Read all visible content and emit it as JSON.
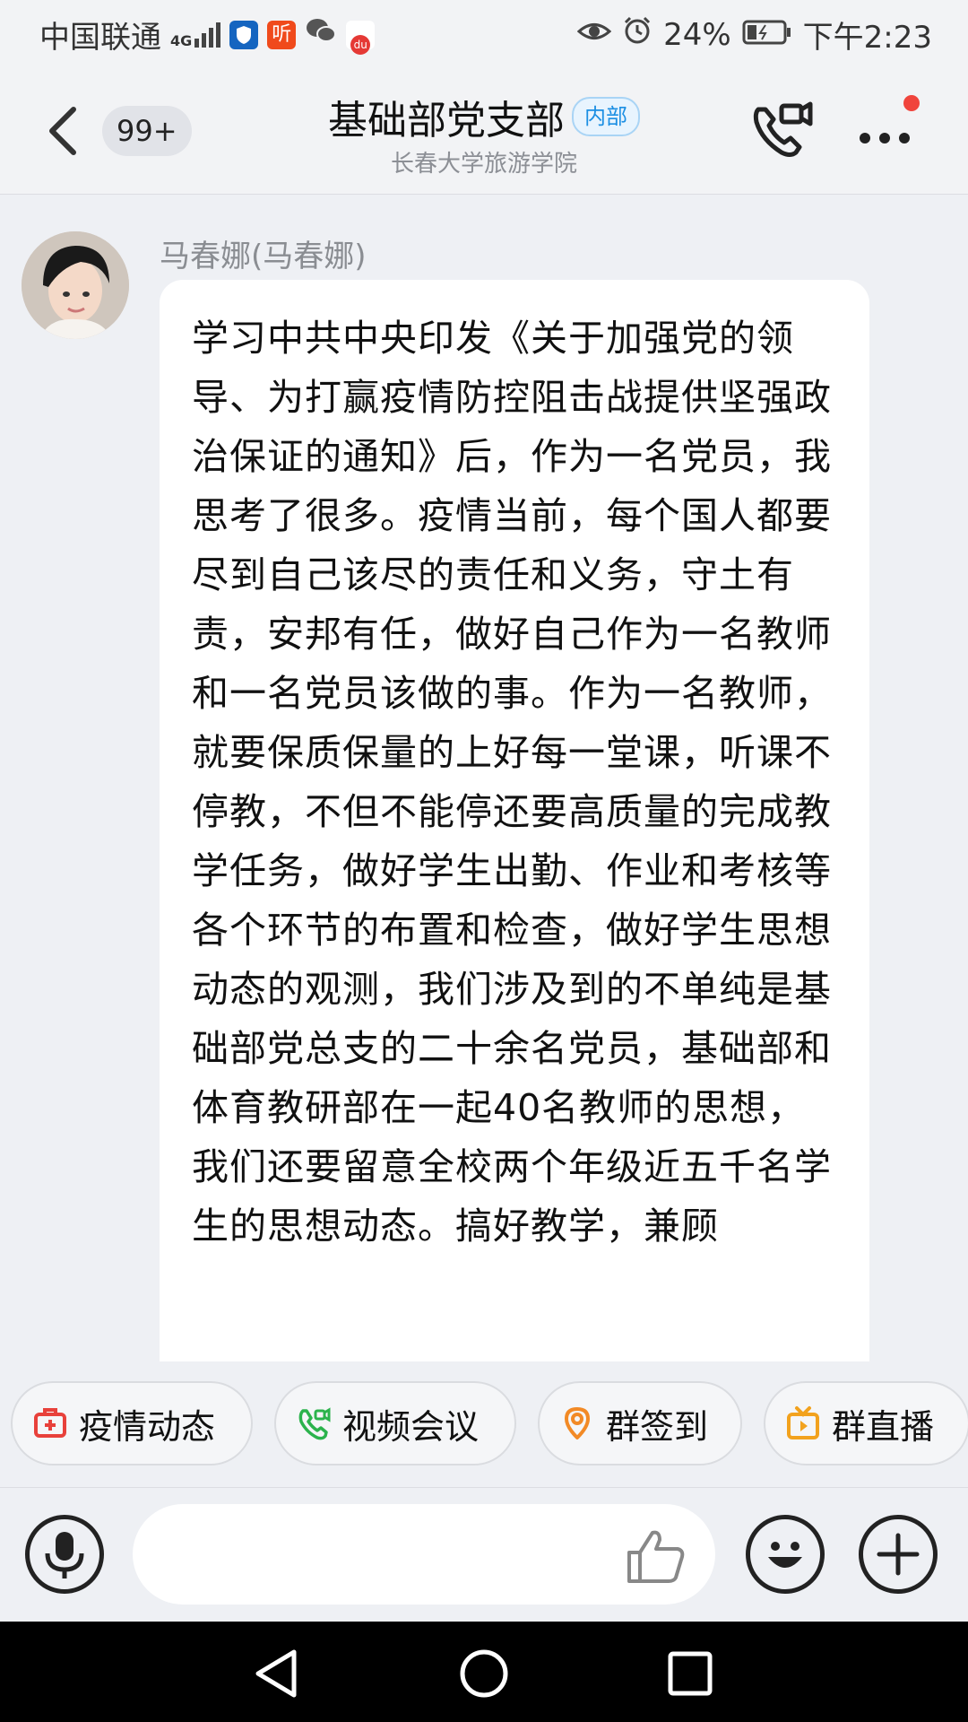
{
  "status_bar": {
    "carrier": "中国联通",
    "network": "4G",
    "battery": "24%",
    "time": "下午2:23",
    "app_icons": [
      "shield-app-icon",
      "ting-app-icon",
      "wechat-icon",
      "du-app-icon"
    ],
    "app_icon_label_ting": "听",
    "app_icon_label_du": "du"
  },
  "header": {
    "back_badge": "99+",
    "title": "基础部党支部",
    "tag": "内部",
    "subtitle": "长春大学旅游学院"
  },
  "message": {
    "sender": "马春娜(马春娜)",
    "text": "学习中共中央印发《关于加强党的领导、为打赢疫情防控阻击战提供坚强政治保证的通知》后，作为一名党员，我思考了很多。疫情当前，每个国人都要尽到自己该尽的责任和义务，守土有责，安邦有任，做好自己作为一名教师和一名党员该做的事。作为一名教师，就要保质保量的上好每一堂课，听课不停教，不但不能停还要高质量的完成教学任务，做好学生出勤、作业和考核等各个环节的布置和检查，做好学生思想动态的观测，我们涉及到的不单纯是基础部党总支的二十余名党员，基础部和体育教研部在一起40名教师的思想，我们还要留意全校两个年级近五千名学生的思想动态。搞好教学，兼顾"
  },
  "quick_actions": [
    {
      "label": "疫情动态",
      "icon": "medical-kit-icon",
      "color": "#e8413b"
    },
    {
      "label": "视频会议",
      "icon": "video-call-icon",
      "color": "#2bb34c"
    },
    {
      "label": "群签到",
      "icon": "location-pin-icon",
      "color": "#f28a26"
    },
    {
      "label": "群直播",
      "icon": "tv-live-icon",
      "color": "#f2a21e"
    }
  ],
  "colors": {
    "accent_blue": "#1c8fe3",
    "red_dot": "#f0443c"
  }
}
